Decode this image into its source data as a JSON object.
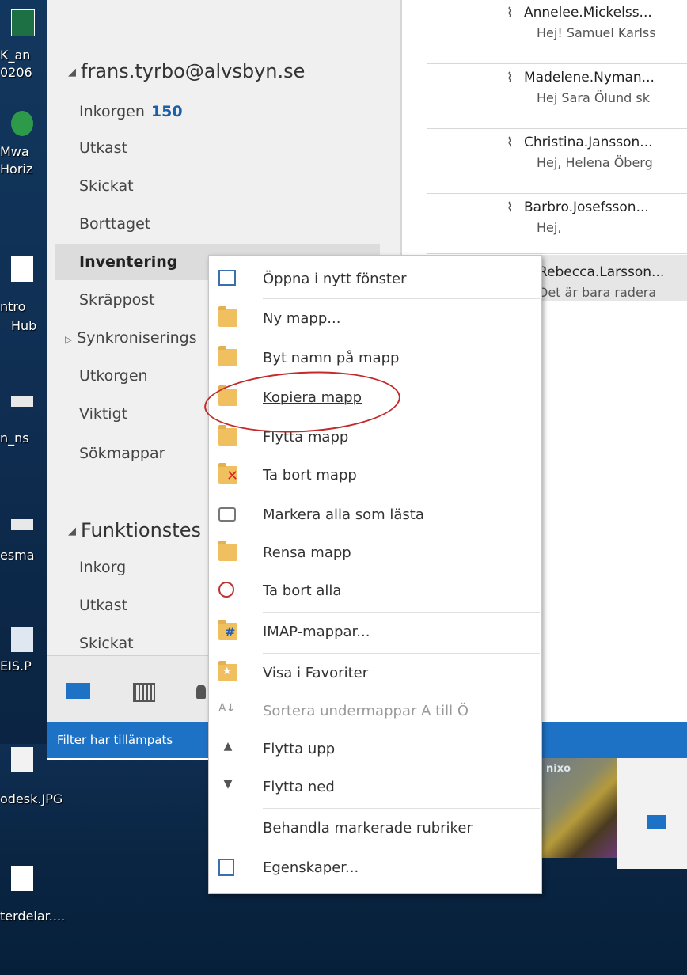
{
  "desktop": {
    "labels": [
      "K_an",
      "0206",
      "Mwa",
      "Horiz",
      "ntro",
      "Hub",
      "n_ns",
      "esma",
      "EIS.P",
      "odesk.JPG",
      "terdelar...."
    ]
  },
  "folders": {
    "account1": "frans.tyrbo@alvsbyn.se",
    "items": [
      {
        "label": "Inkorgen",
        "count": "150"
      },
      {
        "label": "Utkast"
      },
      {
        "label": "Skickat"
      },
      {
        "label": "Borttaget"
      },
      {
        "label": "Inventering"
      },
      {
        "label": "Skräppost"
      },
      {
        "label": "Synkroniserings"
      },
      {
        "label": "Utkorgen"
      },
      {
        "label": "Viktigt"
      },
      {
        "label": "Sökmappar"
      }
    ],
    "account2": "Funktionstes",
    "items2": [
      {
        "label": "Inkorg"
      },
      {
        "label": "Utkast"
      },
      {
        "label": "Skickat"
      }
    ]
  },
  "status": {
    "text": "Filter har tillämpats"
  },
  "mail_list": [
    {
      "from": "Annelee.Mickelss...",
      "preview": "Hej!  Samuel Karlss"
    },
    {
      "from": "Madelene.Nyman...",
      "preview": "Hej  Sara Ölund sk"
    },
    {
      "from": "Christina.Jansson...",
      "preview": "Hej, Helena Öberg"
    },
    {
      "from": "Barbro.Josefsson...",
      "preview": "Hej,"
    },
    {
      "from": "Rebecca.Larsson...",
      "preview": "Det är bara radera"
    }
  ],
  "photo_label": "nixo",
  "context_menu": {
    "items": [
      {
        "label": "Öppna i nytt fönster",
        "icon": "new-window-icon"
      },
      {
        "label": "Ny mapp...",
        "icon": "new-folder-icon"
      },
      {
        "label": "Byt namn på mapp",
        "icon": "rename-folder-icon"
      },
      {
        "label": "Kopiera mapp",
        "icon": "copy-folder-icon"
      },
      {
        "label": "Flytta mapp",
        "icon": "move-folder-icon"
      },
      {
        "label": "Ta bort mapp",
        "icon": "delete-folder-icon"
      },
      {
        "label": "Markera alla som lästa",
        "icon": "mark-read-icon"
      },
      {
        "label": "Rensa mapp",
        "icon": "clean-folder-icon"
      },
      {
        "label": "Ta bort alla",
        "icon": "delete-all-icon"
      },
      {
        "label": "IMAP-mappar...",
        "icon": "imap-folders-icon"
      },
      {
        "label": "Visa i Favoriter",
        "icon": "favorites-icon"
      },
      {
        "label": "Sortera undermappar A till Ö",
        "icon": "sort-az-icon",
        "disabled": true
      },
      {
        "label": "Flytta upp",
        "icon": "arrow-up-icon"
      },
      {
        "label": "Flytta ned",
        "icon": "arrow-down-icon"
      },
      {
        "label": "Behandla markerade rubriker",
        "icon": ""
      },
      {
        "label": "Egenskaper...",
        "icon": "properties-icon"
      }
    ]
  },
  "colors": {
    "accent": "#1e72c6",
    "annotation": "#c42a2a"
  }
}
